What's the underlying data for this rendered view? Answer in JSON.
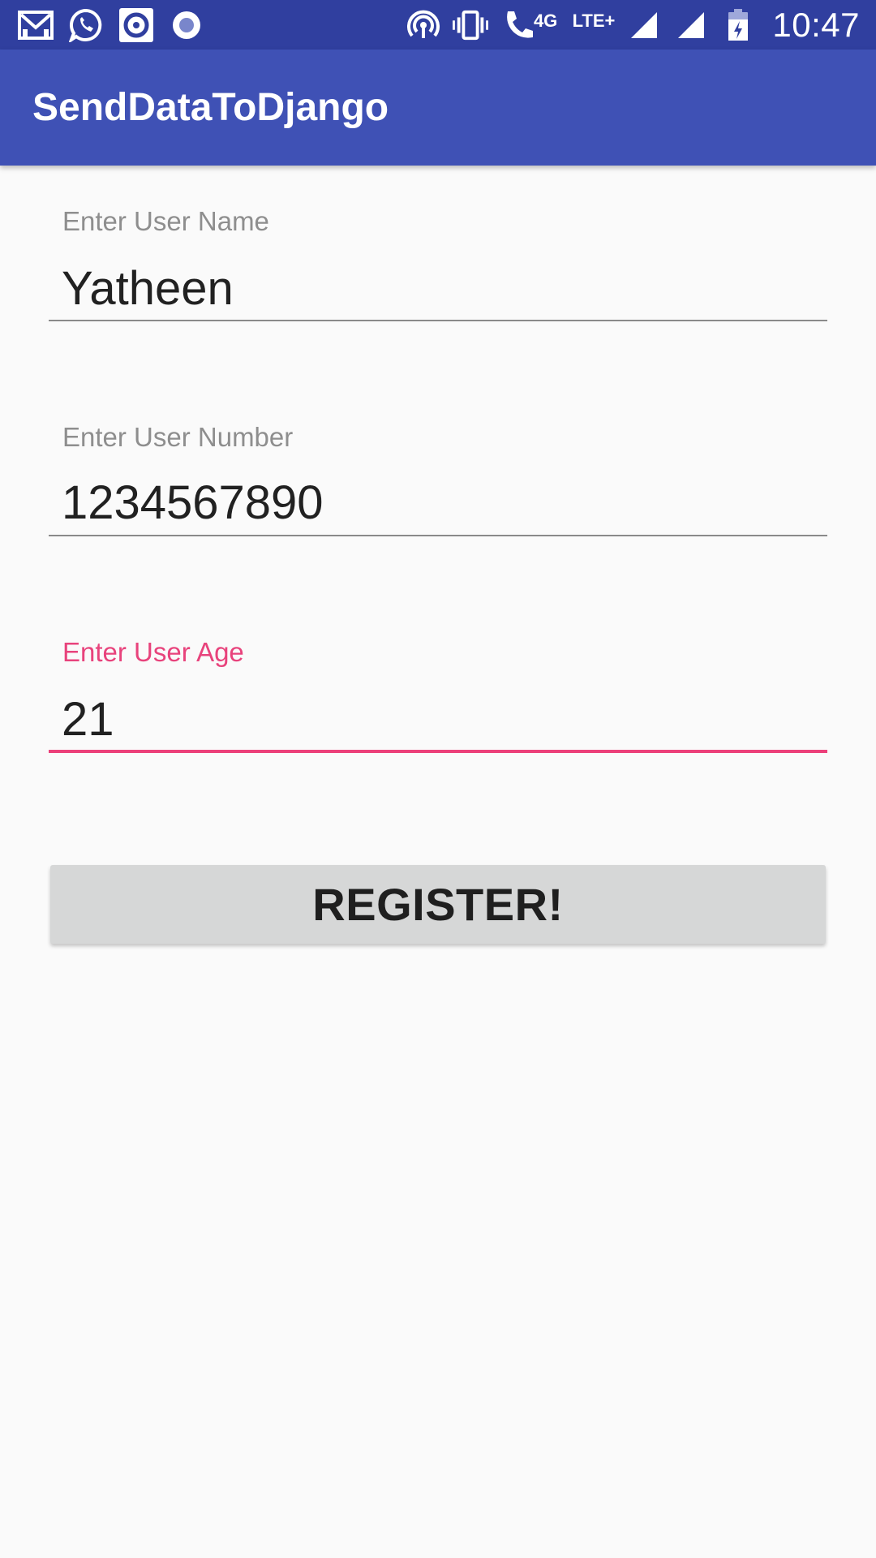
{
  "status_bar": {
    "left_icons": [
      "gmail-icon",
      "whatsapp-icon",
      "music-player-icon",
      "record-icon"
    ],
    "right_icons": [
      "hotspot-icon",
      "vibrate-icon",
      "volte-call-icon",
      "signal-icon",
      "signal-icon",
      "battery-charging-icon"
    ],
    "network_small": "4G",
    "network": "LTE+",
    "time": "10:47",
    "color": "#303f9f"
  },
  "app_bar": {
    "title": "SendDataToDjango",
    "color": "#3f51b5"
  },
  "form": {
    "fields": [
      {
        "label": "Enter User Name",
        "value": "Yatheen",
        "focused": false
      },
      {
        "label": "Enter User Number",
        "value": "1234567890",
        "focused": false
      },
      {
        "label": "Enter User Age",
        "value": "21",
        "focused": true
      }
    ],
    "accent_color": "#ec407a",
    "submit_label": "REGISTER!"
  }
}
